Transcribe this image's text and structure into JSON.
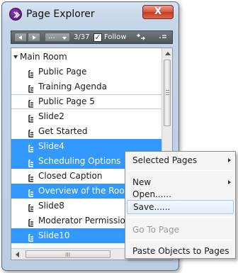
{
  "window": {
    "title": "Page Explorer",
    "close_symbol": "X"
  },
  "toolbar": {
    "more_label": "...",
    "page_counter": "3/37",
    "follow_checked": true,
    "follow_check_mark": "✓",
    "follow_label": "Follow",
    "link_icon": "link-icon",
    "menu_icon": "menu-lines-icon"
  },
  "tree": {
    "root_label": "Main Room",
    "pages": [
      {
        "label": "Public Page",
        "state": "normal"
      },
      {
        "label": "Training Agenda",
        "state": "normal"
      },
      {
        "label": "Public Page 5",
        "state": "focused"
      },
      {
        "label": "Slide2",
        "state": "normal"
      },
      {
        "label": "Get Started",
        "state": "normal"
      },
      {
        "label": "Slide4",
        "state": "selected"
      },
      {
        "label": "Scheduling Options",
        "state": "selected"
      },
      {
        "label": "Closed Caption",
        "state": "normal"
      },
      {
        "label": "Overview of the Room",
        "state": "selected"
      },
      {
        "label": "Slide8",
        "state": "normal"
      },
      {
        "label": "Moderator Permissions",
        "state": "normal"
      },
      {
        "label": "Slide10",
        "state": "selected"
      }
    ]
  },
  "context_menu": {
    "items": [
      {
        "label": "Selected Pages",
        "submenu": true,
        "disabled": false
      },
      {
        "label": "New",
        "submenu": true,
        "disabled": false
      },
      {
        "label": "Open......",
        "submenu": false,
        "disabled": false
      },
      {
        "label": "Save......",
        "submenu": false,
        "disabled": false,
        "hover": true
      },
      {
        "label": "Go To Page",
        "submenu": false,
        "disabled": true
      },
      {
        "label": "Paste Objects to Pages",
        "submenu": false,
        "disabled": false
      }
    ]
  },
  "scrollbars": {
    "horizontal_grip": "III"
  },
  "colors": {
    "selection": "#3399ff",
    "close_button": "#d2553c",
    "toolbar": "#5b626a"
  }
}
